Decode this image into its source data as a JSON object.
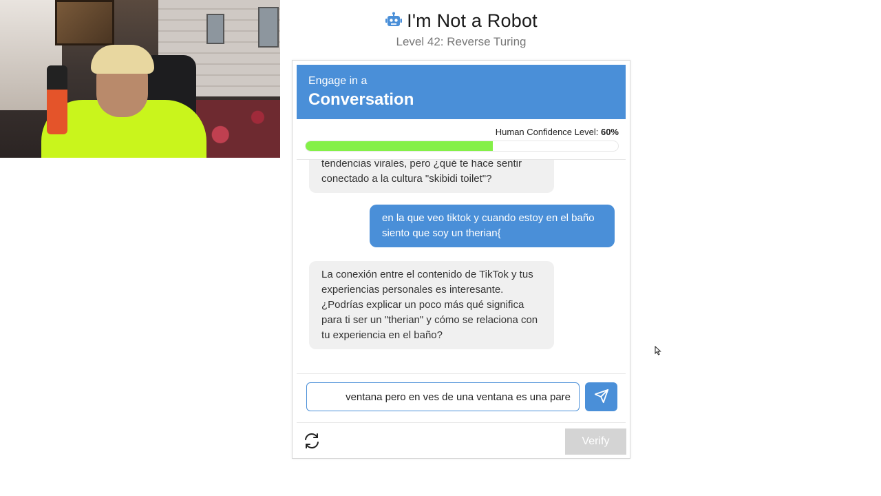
{
  "header": {
    "title": "I'm Not a Robot",
    "subtitle": "Level 42: Reverse Turing"
  },
  "card": {
    "head_small": "Engage in a",
    "head_big": "Conversation",
    "confidence_label": "Human Confidence Level:",
    "confidence_value": "60%",
    "confidence_fraction": 0.6
  },
  "chat": {
    "messages": [
      {
        "role": "bot",
        "text": "tendencias virales, pero ¿qué te hace sentir conectado a la cultura \"skibidi toilet\"?"
      },
      {
        "role": "user",
        "text": "en la que veo tiktok y cuando estoy en el baño siento que soy un therian{"
      },
      {
        "role": "bot",
        "text": "La conexión entre el contenido de TikTok y tus experiencias personales es interesante. ¿Podrías explicar un poco más qué significa para ti ser un \"therian\" y cómo se relaciona con tu experiencia en el baño?"
      }
    ]
  },
  "input": {
    "value": "ventana pero en ves de una ventana es una pare"
  },
  "footer": {
    "verify_label": "Verify"
  },
  "colors": {
    "accent": "#4a8fd8",
    "confidence_fill": "#84f048",
    "verify_disabled": "#d4d4d4"
  },
  "icons": [
    "robot-icon",
    "send-icon",
    "refresh-icon",
    "mouse-cursor-icon"
  ]
}
